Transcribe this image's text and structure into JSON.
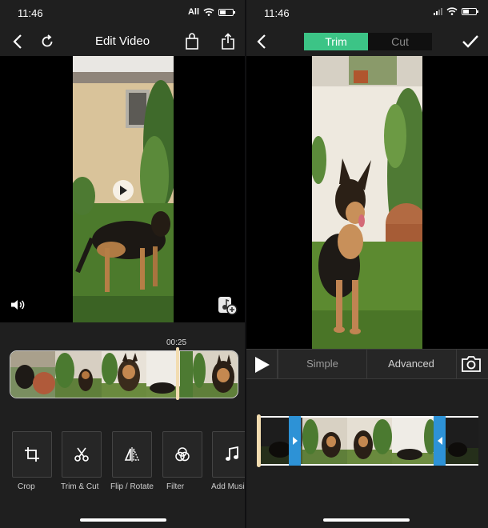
{
  "left": {
    "status": {
      "time": "11:46",
      "carrier": "All"
    },
    "nav": {
      "title": "Edit Video"
    },
    "player": {
      "timestamp": "00:25"
    },
    "tools": [
      {
        "label": "Crop",
        "icon": "crop-icon"
      },
      {
        "label": "Trim & Cut",
        "icon": "scissors-icon"
      },
      {
        "label": "Flip / Rotate",
        "icon": "flip-icon"
      },
      {
        "label": "Filter",
        "icon": "filter-icon"
      },
      {
        "label": "Add Music",
        "icon": "music-note-icon"
      }
    ]
  },
  "right": {
    "status": {
      "time": "11:46"
    },
    "segments": {
      "trim": "Trim",
      "cut": "Cut",
      "selected": "Trim"
    },
    "modes": {
      "simple": "Simple",
      "advanced": "Advanced",
      "selected": "Simple"
    }
  },
  "colors": {
    "accent": "#3cc486",
    "trim_handle": "#2d92d6",
    "playhead": "#f2dcb0"
  }
}
